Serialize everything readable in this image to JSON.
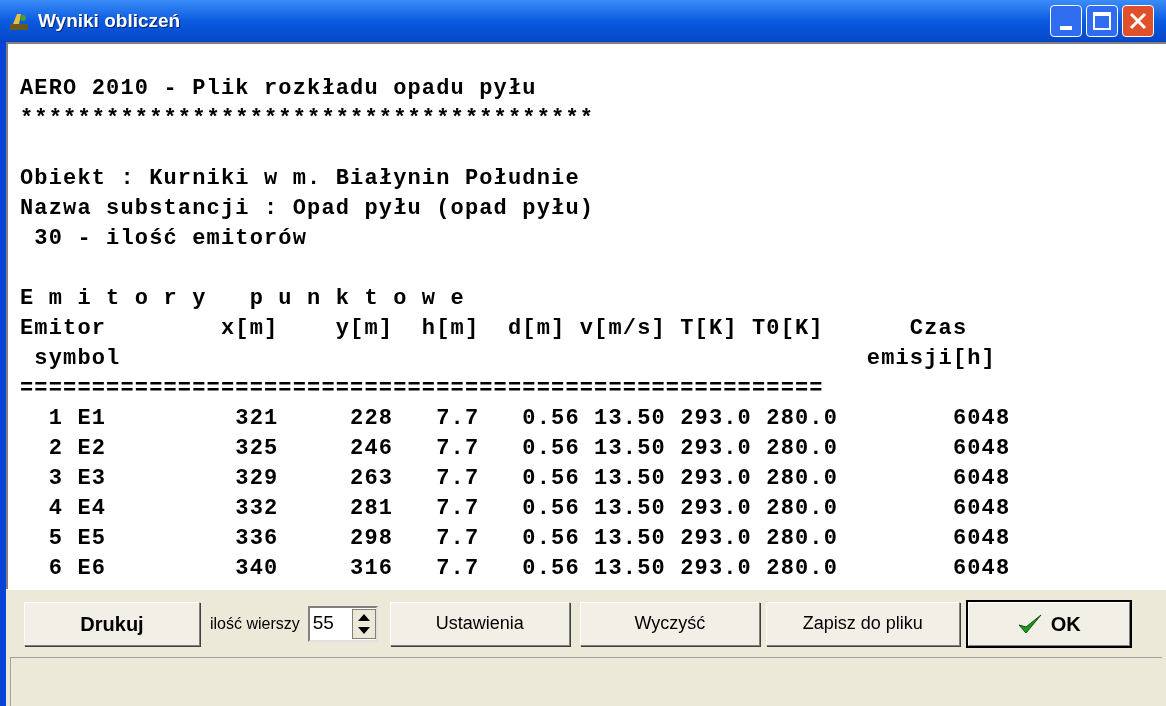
{
  "window": {
    "title": "Wyniki obliczeń"
  },
  "report": {
    "blocks": [
      [
        "AERO 2010 - Plik rozkładu opadu pyłu",
        "****************************************"
      ],
      [
        "Obiekt : Kurniki w m. Białynin Południe",
        "Nazwa substancji : Opad pyłu (opad pyłu)",
        " 30 - ilość emitorów"
      ],
      [
        "E m i t o r y   p u n k t o w e",
        "Emitor        x[m]    y[m]  h[m]  d[m] v[m/s] T[K] T0[K]      Czas",
        " symbol                                                    emisji[h]",
        "========================================================",
        "  1 E1         321     228   7.7   0.56 13.50 293.0 280.0        6048",
        "  2 E2         325     246   7.7   0.56 13.50 293.0 280.0        6048",
        "  3 E3         329     263   7.7   0.56 13.50 293.0 280.0        6048",
        "  4 E4         332     281   7.7   0.56 13.50 293.0 280.0        6048",
        "  5 E5         336     298   7.7   0.56 13.50 293.0 280.0        6048",
        "  6 E6         340     316   7.7   0.56 13.50 293.0 280.0        6048"
      ]
    ]
  },
  "toolbar": [
    {
      "kind": "button",
      "label": "Drukuj",
      "bold": true
    },
    {
      "kind": "spinner",
      "label": "ilość wierszy",
      "value": "55"
    },
    {
      "kind": "button",
      "label": "Ustawienia",
      "bold": false
    },
    {
      "kind": "button",
      "label": "Wyczyść",
      "bold": false
    },
    {
      "kind": "button",
      "label": "Zapisz do pliku",
      "bold": false
    },
    {
      "kind": "ok_button",
      "label": "OK",
      "bold": true
    }
  ]
}
